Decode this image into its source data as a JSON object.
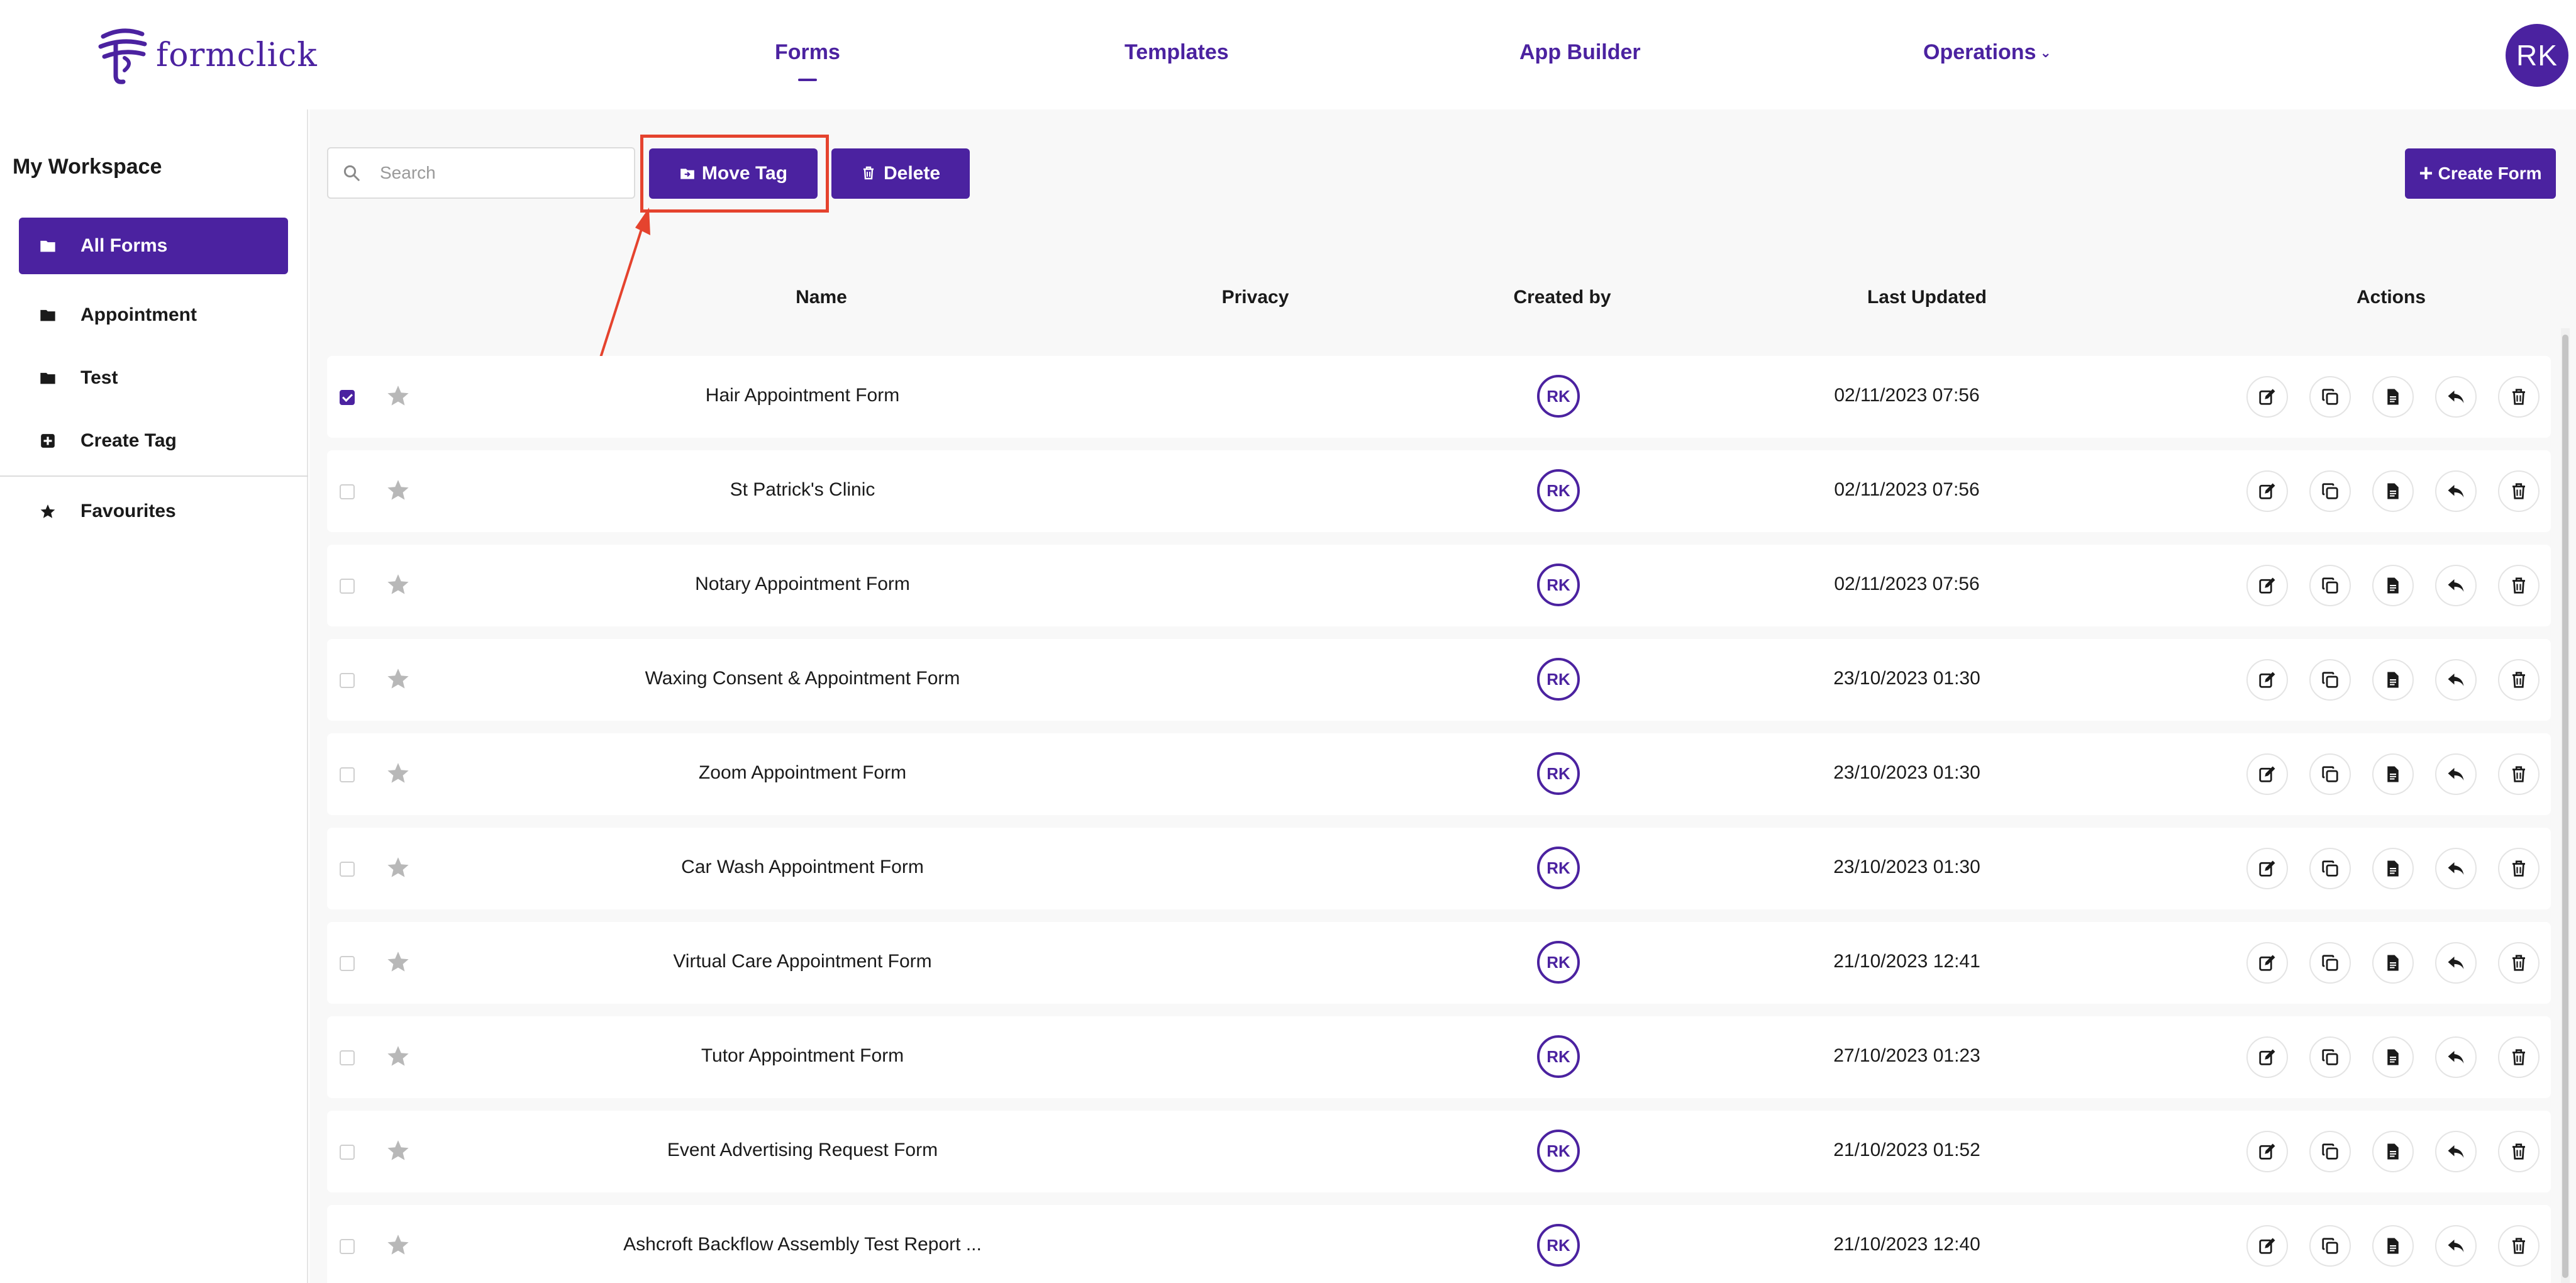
{
  "brand": {
    "name": "formclick",
    "accent": "#4b22a0",
    "highlight": "#e5432e"
  },
  "nav": {
    "forms": "Forms",
    "templates": "Templates",
    "app_builder": "App Builder",
    "operations": "Operations",
    "active": "Forms"
  },
  "user": {
    "initials": "RK"
  },
  "sidebar": {
    "title": "My Workspace",
    "items": [
      {
        "label": "All Forms",
        "icon": "folder-icon"
      },
      {
        "label": "Appointment",
        "icon": "folder-icon"
      },
      {
        "label": "Test",
        "icon": "folder-icon"
      },
      {
        "label": "Create Tag",
        "icon": "plus-square-icon"
      },
      {
        "label": "Favourites",
        "icon": "star-icon"
      }
    ]
  },
  "toolbar": {
    "search_placeholder": "Search",
    "move_tag": "Move Tag",
    "delete": "Delete",
    "create_form": "Create Form"
  },
  "table": {
    "headers": {
      "name": "Name",
      "privacy": "Privacy",
      "created_by": "Created by",
      "last_updated": "Last Updated",
      "actions": "Actions"
    },
    "rows": [
      {
        "name": "Hair Appointment Form",
        "created_by": "RK",
        "updated": "02/11/2023 07:56",
        "checked": true
      },
      {
        "name": "St Patrick's Clinic",
        "created_by": "RK",
        "updated": "02/11/2023 07:56",
        "checked": false
      },
      {
        "name": "Notary Appointment Form",
        "created_by": "RK",
        "updated": "02/11/2023 07:56",
        "checked": false
      },
      {
        "name": "Waxing Consent & Appointment Form",
        "created_by": "RK",
        "updated": "23/10/2023 01:30",
        "checked": false
      },
      {
        "name": "Zoom Appointment Form",
        "created_by": "RK",
        "updated": "23/10/2023 01:30",
        "checked": false
      },
      {
        "name": "Car Wash Appointment Form",
        "created_by": "RK",
        "updated": "23/10/2023 01:30",
        "checked": false
      },
      {
        "name": "Virtual Care Appointment Form",
        "created_by": "RK",
        "updated": "21/10/2023 12:41",
        "checked": false
      },
      {
        "name": "Tutor Appointment Form",
        "created_by": "RK",
        "updated": "27/10/2023 01:23",
        "checked": false
      },
      {
        "name": "Event Advertising Request Form",
        "created_by": "RK",
        "updated": "21/10/2023 01:52",
        "checked": false
      },
      {
        "name": "Ashcroft Backflow Assembly Test Report ...",
        "created_by": "RK",
        "updated": "21/10/2023 12:40",
        "checked": false
      }
    ],
    "action_icons": [
      "edit-icon",
      "copy-icon",
      "document-icon",
      "share-back-icon",
      "trash-icon"
    ]
  }
}
